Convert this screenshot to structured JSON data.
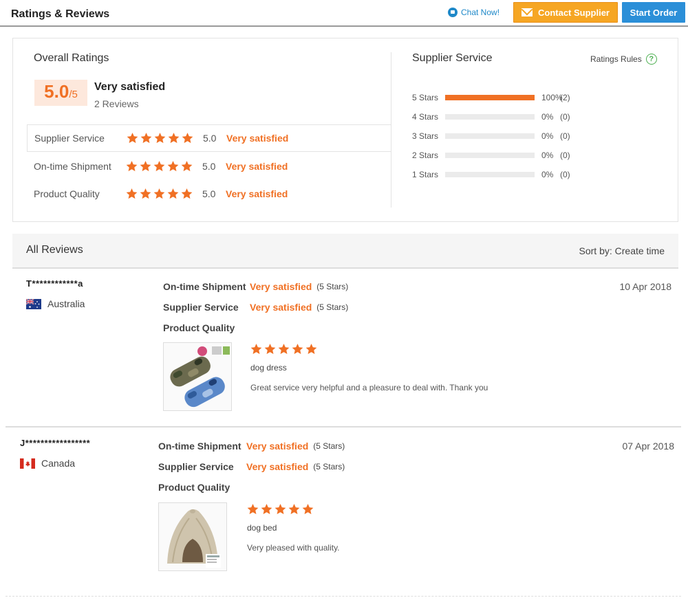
{
  "header": {
    "title": "Ratings & Reviews",
    "chat_label": "Chat Now!",
    "contact_label": "Contact Supplier",
    "order_label": "Start Order"
  },
  "overall": {
    "title": "Overall Ratings",
    "score": "5.0",
    "out_of": "/5",
    "label": "Very satisfied",
    "count": "2 Reviews",
    "categories": [
      {
        "label": "Supplier Service",
        "score": "5.0",
        "satisfaction": "Very satisfied",
        "stars": 5
      },
      {
        "label": "On-time Shipment",
        "score": "5.0",
        "satisfaction": "Very satisfied",
        "stars": 5
      },
      {
        "label": "Product Quality",
        "score": "5.0",
        "satisfaction": "Very satisfied",
        "stars": 5
      }
    ]
  },
  "supplier_service": {
    "title": "Supplier Service",
    "rules_label": "Ratings Rules",
    "rules_icon": "question-icon",
    "bars": [
      {
        "label": "5 Stars",
        "percent": "100%",
        "count": "(2)",
        "fraction": 1.0
      },
      {
        "label": "4 Stars",
        "percent": "0%",
        "count": "(0)",
        "fraction": 0
      },
      {
        "label": "3 Stars",
        "percent": "0%",
        "count": "(0)",
        "fraction": 0
      },
      {
        "label": "2 Stars",
        "percent": "0%",
        "count": "(0)",
        "fraction": 0
      },
      {
        "label": "1 Stars",
        "percent": "0%",
        "count": "(0)",
        "fraction": 0
      }
    ]
  },
  "all_reviews": {
    "title": "All Reviews",
    "sort_label": "Sort by: Create time"
  },
  "reviews": [
    {
      "reviewer": "T************a",
      "country": "Australia",
      "date": "10 Apr 2018",
      "shipment_label": "On-time Shipment",
      "shipment_value": "Very satisfied",
      "shipment_stars": "(5 Stars)",
      "service_label": "Supplier Service",
      "service_value": "Very satisfied",
      "service_stars": "(5 Stars)",
      "quality_label": "Product Quality",
      "product_name": "dog dress",
      "comment": "Great service very helpful and a pleasure to deal with. Thank you",
      "stars": 5
    },
    {
      "reviewer": "J*****************",
      "country": "Canada",
      "date": "07 Apr 2018",
      "shipment_label": "On-time Shipment",
      "shipment_value": "Very satisfied",
      "shipment_stars": "(5 Stars)",
      "service_label": "Supplier Service",
      "service_value": "Very satisfied",
      "service_stars": "(5 Stars)",
      "quality_label": "Product Quality",
      "product_name": "dog bed",
      "comment": "Very pleased with quality.",
      "stars": 5
    }
  ],
  "colors": {
    "accent": "#f07024",
    "contact_button": "#f6a623",
    "order_button": "#2b8fd8",
    "link": "#1e88c8"
  }
}
